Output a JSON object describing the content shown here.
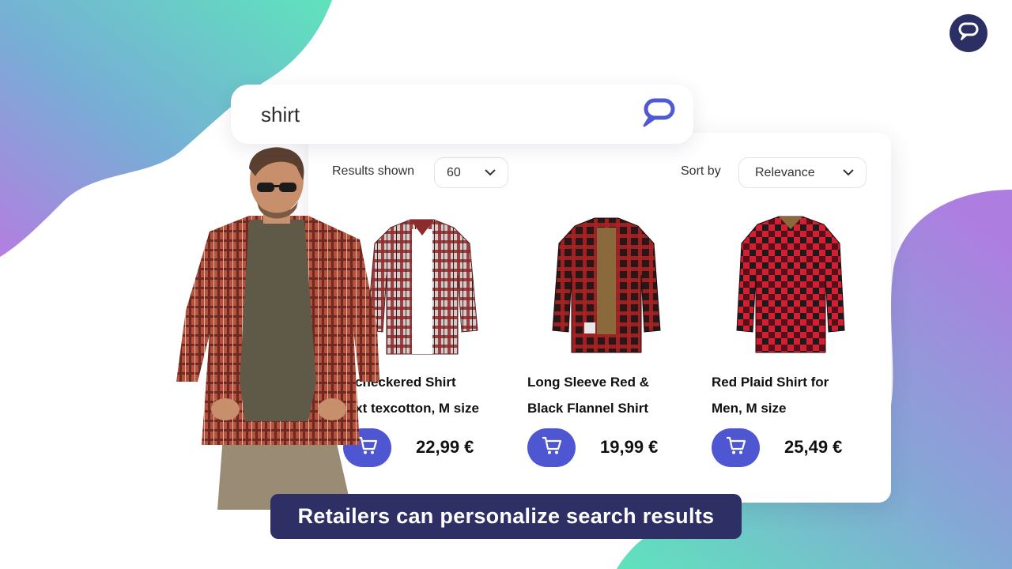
{
  "brand": {
    "icon": "chat-bubble-icon",
    "color": "#2c2f63"
  },
  "search": {
    "query": "shirt",
    "button_icon": "chat-search-icon"
  },
  "filters": {
    "results_label": "Results shown",
    "results_value": "60",
    "sort_label": "Sort by",
    "sort_value": "Relevance"
  },
  "products": [
    {
      "title_line1": "d checkered Shirt",
      "title_line2": "text texcotton, M size",
      "price": "22,99 €",
      "cart_icon": "cart-icon"
    },
    {
      "title_line1": "Long Sleeve Red &",
      "title_line2": "Black Flannel Shirt",
      "price": "19,99 €",
      "cart_icon": "cart-icon"
    },
    {
      "title_line1": "Red Plaid Shirt for",
      "title_line2": "Men, M size",
      "price": "25,49 €",
      "cart_icon": "cart-icon"
    }
  ],
  "caption": "Retailers can personalize search results",
  "colors": {
    "accent": "#4e56d2",
    "caption_bg": "#2d2f65",
    "gradient_teal": "#5fe0bd",
    "gradient_purple": "#ab7fe0"
  }
}
